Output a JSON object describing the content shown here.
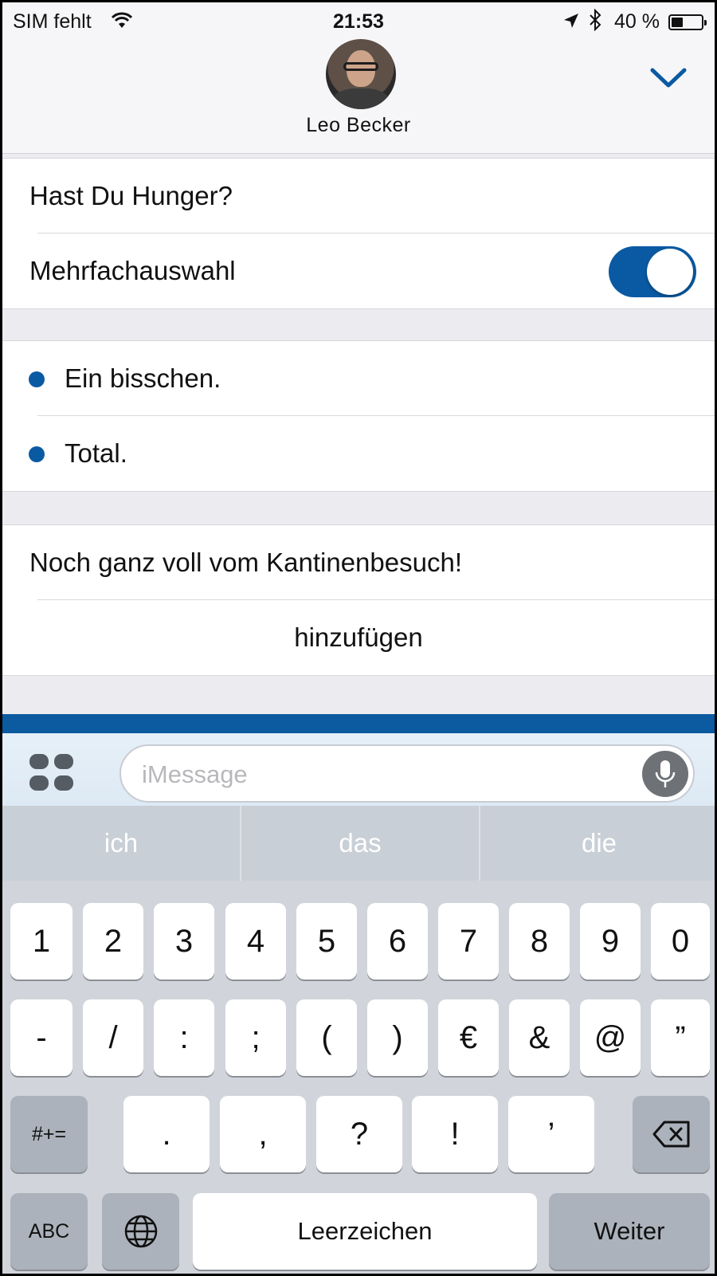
{
  "status_bar": {
    "carrier": "SIM fehlt",
    "time": "21:53",
    "battery_text": "40 %",
    "battery_level": 0.4,
    "icons": [
      "wifi-icon",
      "location-arrow-icon",
      "bluetooth-icon",
      "battery-icon"
    ]
  },
  "header": {
    "contact_name": "Leo Becker",
    "collapse_icon": "chevron-down-icon"
  },
  "poll": {
    "question": "Hast Du Hunger?",
    "multi_select_label": "Mehrfachauswahl",
    "multi_select_on": true,
    "options": [
      "Ein bisschen.",
      "Total."
    ],
    "comment": "Noch ganz voll vom Kantinenbesuch!",
    "add_label": "hinzufügen"
  },
  "message_bar": {
    "placeholder": "iMessage",
    "apps_icon": "app-drawer-icon",
    "mic_icon": "microphone-icon"
  },
  "keyboard": {
    "suggestions": [
      "ich",
      "das",
      "die"
    ],
    "row1": [
      "1",
      "2",
      "3",
      "4",
      "5",
      "6",
      "7",
      "8",
      "9",
      "0"
    ],
    "row2": [
      "-",
      "/",
      ":",
      ";",
      "(",
      ")",
      "€",
      "&",
      "@",
      "”"
    ],
    "row3_left": "#+=",
    "row3": [
      ".",
      ",",
      "?",
      "!",
      "’"
    ],
    "delete_icon": "backspace-icon",
    "abc": "ABC",
    "globe_icon": "globe-icon",
    "space": "Leerzeichen",
    "return": "Weiter"
  },
  "colors": {
    "accent": "#0a5aa3",
    "keyboard_bg": "#d1d5db"
  }
}
